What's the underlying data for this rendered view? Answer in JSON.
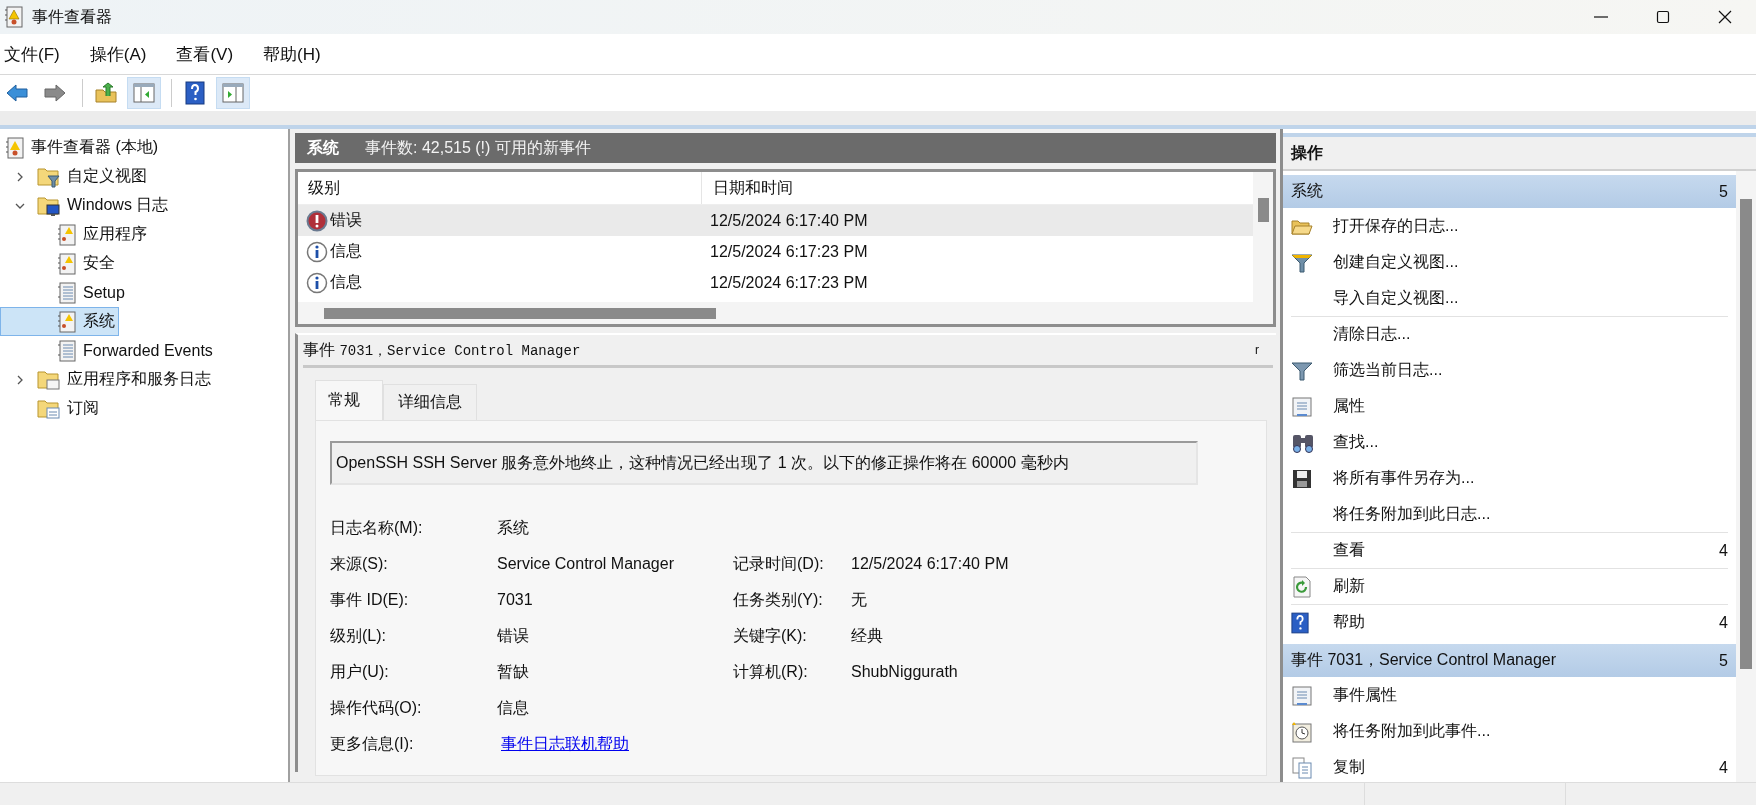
{
  "window": {
    "title": "事件查看器"
  },
  "menu": [
    "文件(F)",
    "操作(A)",
    "查看(V)",
    "帮助(H)"
  ],
  "toolbar": [
    {
      "kind": "back",
      "selected": false
    },
    {
      "kind": "forward",
      "selected": false
    },
    {
      "kind": "up-folder",
      "selected": false
    },
    {
      "kind": "tree-pane",
      "selected": true
    },
    {
      "kind": "help",
      "selected": false
    },
    {
      "kind": "action-pane",
      "selected": true
    }
  ],
  "tree": [
    {
      "label": "事件查看器 (本地)",
      "kind": "viewer",
      "selected": false,
      "children": [
        {
          "label": "自定义视图",
          "kind": "folder-filter",
          "expanded": false,
          "selected": false
        },
        {
          "label": "Windows 日志",
          "kind": "folder-monitor",
          "expanded": true,
          "selected": false,
          "children": [
            {
              "label": "应用程序",
              "kind": "log",
              "selected": false
            },
            {
              "label": "安全",
              "kind": "log",
              "selected": false
            },
            {
              "label": "Setup",
              "kind": "log-plain",
              "selected": false
            },
            {
              "label": "系统",
              "kind": "log",
              "selected": true
            },
            {
              "label": "Forwarded Events",
              "kind": "log-plain",
              "selected": false
            }
          ]
        },
        {
          "label": "应用程序和服务日志",
          "kind": "folder",
          "expanded": false,
          "selected": false
        },
        {
          "label": "订阅",
          "kind": "subscription",
          "selected": false
        }
      ]
    }
  ],
  "pane_header": {
    "title": "系统",
    "summary": "事件数: 42,515 (!) 可用的新事件"
  },
  "events_table": {
    "columns": [
      "级别",
      "日期和时间"
    ],
    "rows": [
      {
        "kind": "error",
        "severity": "错误",
        "datetime": "12/5/2024 6:17:40 PM",
        "selected": true
      },
      {
        "kind": "info",
        "severity": "信息",
        "datetime": "12/5/2024 6:17:23 PM",
        "selected": false
      },
      {
        "kind": "info",
        "severity": "信息",
        "datetime": "12/5/2024 6:17:23 PM",
        "selected": false
      }
    ]
  },
  "event_detail": {
    "title_prefix": "事件",
    "title": "7031，Service Control Manager",
    "corner_mark": "r",
    "tabs": [
      {
        "label": "常规",
        "selected": true
      },
      {
        "label": "详细信息",
        "selected": false
      }
    ],
    "message": "OpenSSH SSH Server 服务意外地终止，这种情况已经出现了 1 次。以下的修正操作将在 60000 毫秒内",
    "rows": [
      {
        "cells": [
          {
            "label": "日志名称(M):",
            "value": "系统",
            "kind": "text"
          }
        ]
      },
      {
        "cells": [
          {
            "label": "来源(S):",
            "value": "Service Control Manager",
            "kind": "text"
          },
          {
            "label": "记录时间(D):",
            "value": "12/5/2024 6:17:40 PM",
            "kind": "text"
          }
        ]
      },
      {
        "cells": [
          {
            "label": "事件 ID(E):",
            "value": "7031",
            "kind": "text"
          },
          {
            "label": "任务类别(Y):",
            "value": "无",
            "kind": "text"
          }
        ]
      },
      {
        "cells": [
          {
            "label": "级别(L):",
            "value": "错误",
            "kind": "text"
          },
          {
            "label": "关键字(K):",
            "value": "经典",
            "kind": "text"
          }
        ]
      },
      {
        "cells": [
          {
            "label": "用户(U):",
            "value": "暂缺",
            "kind": "text"
          },
          {
            "label": "计算机(R):",
            "value": "ShubNiggurath",
            "kind": "text"
          }
        ]
      },
      {
        "cells": [
          {
            "label": "操作代码(O):",
            "value": "信息",
            "kind": "text"
          }
        ]
      },
      {
        "cells": [
          {
            "label": "更多信息(I):",
            "value": "事件日志联机帮助",
            "kind": "link"
          }
        ]
      }
    ]
  },
  "actions": {
    "title": "操作",
    "sections": [
      {
        "title": "系统",
        "count": "5",
        "items": [
          {
            "label": "打开保存的日志...",
            "kind": "open-folder",
            "divider": false
          },
          {
            "label": "创建自定义视图...",
            "kind": "funnel-star",
            "divider": false
          },
          {
            "label": "导入自定义视图...",
            "kind": "none",
            "divider": false
          },
          {
            "label": "清除日志...",
            "kind": "none",
            "divider": true
          },
          {
            "label": "筛选当前日志...",
            "kind": "funnel",
            "divider": false
          },
          {
            "label": "属性",
            "kind": "properties",
            "divider": false
          },
          {
            "label": "查找...",
            "kind": "binoculars",
            "divider": false
          },
          {
            "label": "将所有事件另存为...",
            "kind": "floppy",
            "divider": false
          },
          {
            "label": "将任务附加到此日志...",
            "kind": "none",
            "divider": false
          },
          {
            "label": "查看",
            "kind": "none",
            "divider": true,
            "count": "4"
          },
          {
            "label": "刷新",
            "kind": "refresh",
            "divider": true
          },
          {
            "label": "帮助",
            "kind": "help",
            "divider": true,
            "count": "4"
          }
        ]
      },
      {
        "title": "事件 7031，Service Control Manager",
        "count": "5",
        "items": [
          {
            "label": "事件属性",
            "kind": "properties",
            "divider": false
          },
          {
            "label": "将任务附加到此事件...",
            "kind": "task-clock",
            "divider": false
          },
          {
            "label": "复制",
            "kind": "copy",
            "divider": false,
            "count": "4"
          }
        ]
      }
    ]
  }
}
